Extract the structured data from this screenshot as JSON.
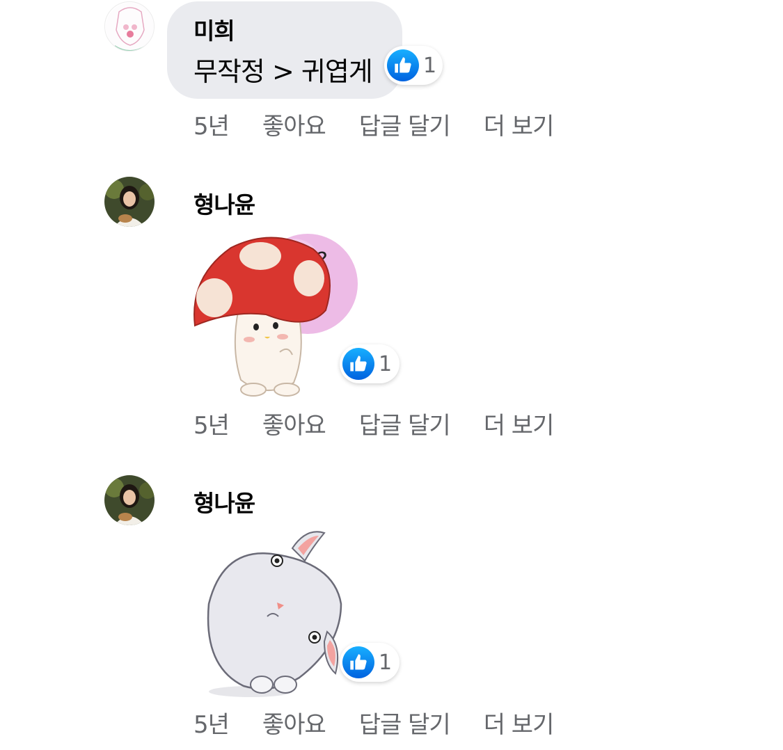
{
  "comments": [
    {
      "author": "미희",
      "text": "무작정 > 귀엽게",
      "reaction_count": "1",
      "time": "5년",
      "like_label": "좋아요",
      "reply_label": "답글 달기",
      "more_label": "더 보기"
    },
    {
      "author": "형나윤",
      "sticker": "mushroom-sticker",
      "reaction_count": "1",
      "time": "5년",
      "like_label": "좋아요",
      "reply_label": "답글 달기",
      "more_label": "더 보기"
    },
    {
      "author": "형나윤",
      "sticker": "bunny-sticker",
      "reaction_count": "1",
      "time": "5년",
      "like_label": "좋아요",
      "reply_label": "답글 달기",
      "more_label": "더 보기"
    }
  ],
  "colors": {
    "bubble": "#eaebef",
    "meta_text": "#65676b",
    "like_blue": "#1877f2"
  }
}
